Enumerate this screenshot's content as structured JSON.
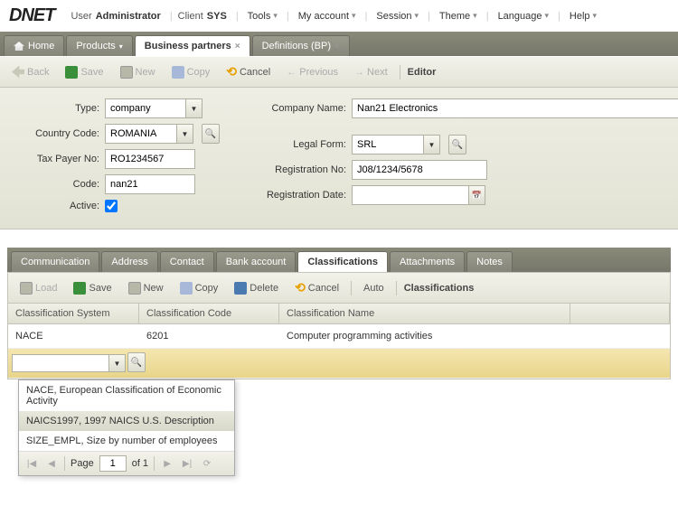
{
  "brand": "DNET",
  "header": {
    "user_lbl": "User",
    "user_val": "Administrator",
    "client_lbl": "Client",
    "client_val": "SYS",
    "menu": [
      "Tools",
      "My account",
      "Session",
      "Theme",
      "Language",
      "Help"
    ]
  },
  "tabs": [
    {
      "label": "Home",
      "kind": "home"
    },
    {
      "label": "Products",
      "kind": "drop"
    },
    {
      "label": "Business partners",
      "kind": "active"
    },
    {
      "label": "Definitions (BP)",
      "kind": "close"
    }
  ],
  "toolbar_main": {
    "back": "Back",
    "save": "Save",
    "new": "New",
    "copy": "Copy",
    "cancel": "Cancel",
    "prev": "Previous",
    "next": "Next",
    "label": "Editor"
  },
  "form": {
    "type_lbl": "Type:",
    "type_val": "company",
    "country_lbl": "Country Code:",
    "country_val": "ROMANIA",
    "tax_lbl": "Tax Payer No:",
    "tax_val": "RO1234567",
    "code_lbl": "Code:",
    "code_val": "nan21",
    "active_lbl": "Active:",
    "active_val": true,
    "company_lbl": "Company Name:",
    "company_val": "Nan21 Electronics",
    "legal_lbl": "Legal Form:",
    "legal_val": "SRL",
    "reg_lbl": "Registration No:",
    "reg_val": "J08/1234/5678",
    "regdate_lbl": "Registration Date:",
    "regdate_val": ""
  },
  "subtabs": [
    "Communication",
    "Address",
    "Contact",
    "Bank account",
    "Classifications",
    "Attachments",
    "Notes"
  ],
  "subtab_active": "Classifications",
  "toolbar_sub": {
    "load": "Load",
    "save": "Save",
    "new": "New",
    "copy": "Copy",
    "delete": "Delete",
    "cancel": "Cancel",
    "auto": "Auto",
    "label": "Classifications"
  },
  "grid": {
    "cols": [
      "Classification System",
      "Classification Code",
      "Classification Name"
    ],
    "rows": [
      {
        "system": "NACE",
        "code": "6201",
        "name": "Computer programming activities"
      }
    ]
  },
  "dropdown": {
    "items": [
      "NACE, European Classification of Economic Activity",
      "NAICS1997, 1997 NAICS U.S. Description",
      "SIZE_EMPL, Size by number of employees"
    ],
    "hover_idx": 1
  },
  "pager": {
    "page_lbl": "Page",
    "page": "1",
    "of_lbl": "of 1"
  }
}
